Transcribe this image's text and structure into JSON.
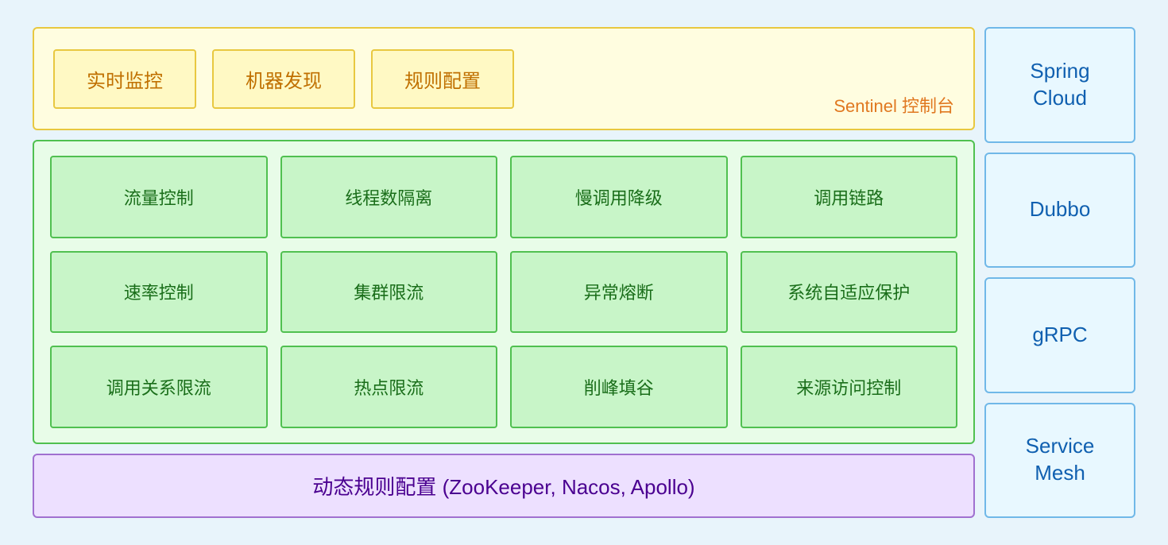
{
  "sentinel": {
    "label": "Sentinel 控制台",
    "boxes": [
      {
        "id": "realtime",
        "text": "实时监控"
      },
      {
        "id": "discovery",
        "text": "机器发现"
      },
      {
        "id": "rules",
        "text": "规则配置"
      }
    ]
  },
  "features": [
    {
      "id": "flow-control",
      "text": "流量控制"
    },
    {
      "id": "thread-isolation",
      "text": "线程数隔离"
    },
    {
      "id": "slow-call-degrade",
      "text": "慢调用降级"
    },
    {
      "id": "call-chain",
      "text": "调用链路"
    },
    {
      "id": "rate-control",
      "text": "速率控制"
    },
    {
      "id": "cluster-limit",
      "text": "集群限流"
    },
    {
      "id": "exception-circuit",
      "text": "异常熔断"
    },
    {
      "id": "system-adaptive",
      "text": "系统自适应保护"
    },
    {
      "id": "relation-limit",
      "text": "调用关系限流"
    },
    {
      "id": "hotspot-limit",
      "text": "热点限流"
    },
    {
      "id": "peak-shaving",
      "text": "削峰填谷"
    },
    {
      "id": "source-access",
      "text": "来源访问控制"
    }
  ],
  "dynamic": {
    "text": "动态规则配置 (ZooKeeper, Nacos, Apollo)"
  },
  "sidebar": [
    {
      "id": "spring-cloud",
      "text": "Spring\nCloud"
    },
    {
      "id": "dubbo",
      "text": "Dubbo"
    },
    {
      "id": "grpc",
      "text": "gRPC"
    },
    {
      "id": "service-mesh",
      "text": "Service\nMesh"
    }
  ]
}
